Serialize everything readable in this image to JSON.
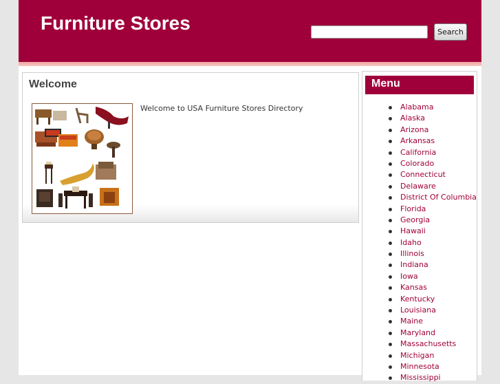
{
  "header": {
    "site_title": "Furniture Stores",
    "search_placeholder": "",
    "search_button": "Search"
  },
  "main": {
    "title": "Welcome",
    "welcome_text": "Welcome to USA Furniture Stores Directory"
  },
  "sidebar": {
    "menu_title": "Menu",
    "items": [
      "Alabama",
      "Alaska",
      "Arizona",
      "Arkansas",
      "California",
      "Colorado",
      "Connecticut",
      "Delaware",
      "District Of Columbia",
      "Florida",
      "Georgia",
      "Hawaii",
      "Idaho",
      "Illinois",
      "Indiana",
      "Iowa",
      "Kansas",
      "Kentucky",
      "Louisiana",
      "Maine",
      "Maryland",
      "Massachusetts",
      "Michigan",
      "Minnesota",
      "Mississippi"
    ]
  },
  "colors": {
    "brand": "#a0003a",
    "link": "#a0003a",
    "stripe": "#f2a4a4"
  }
}
